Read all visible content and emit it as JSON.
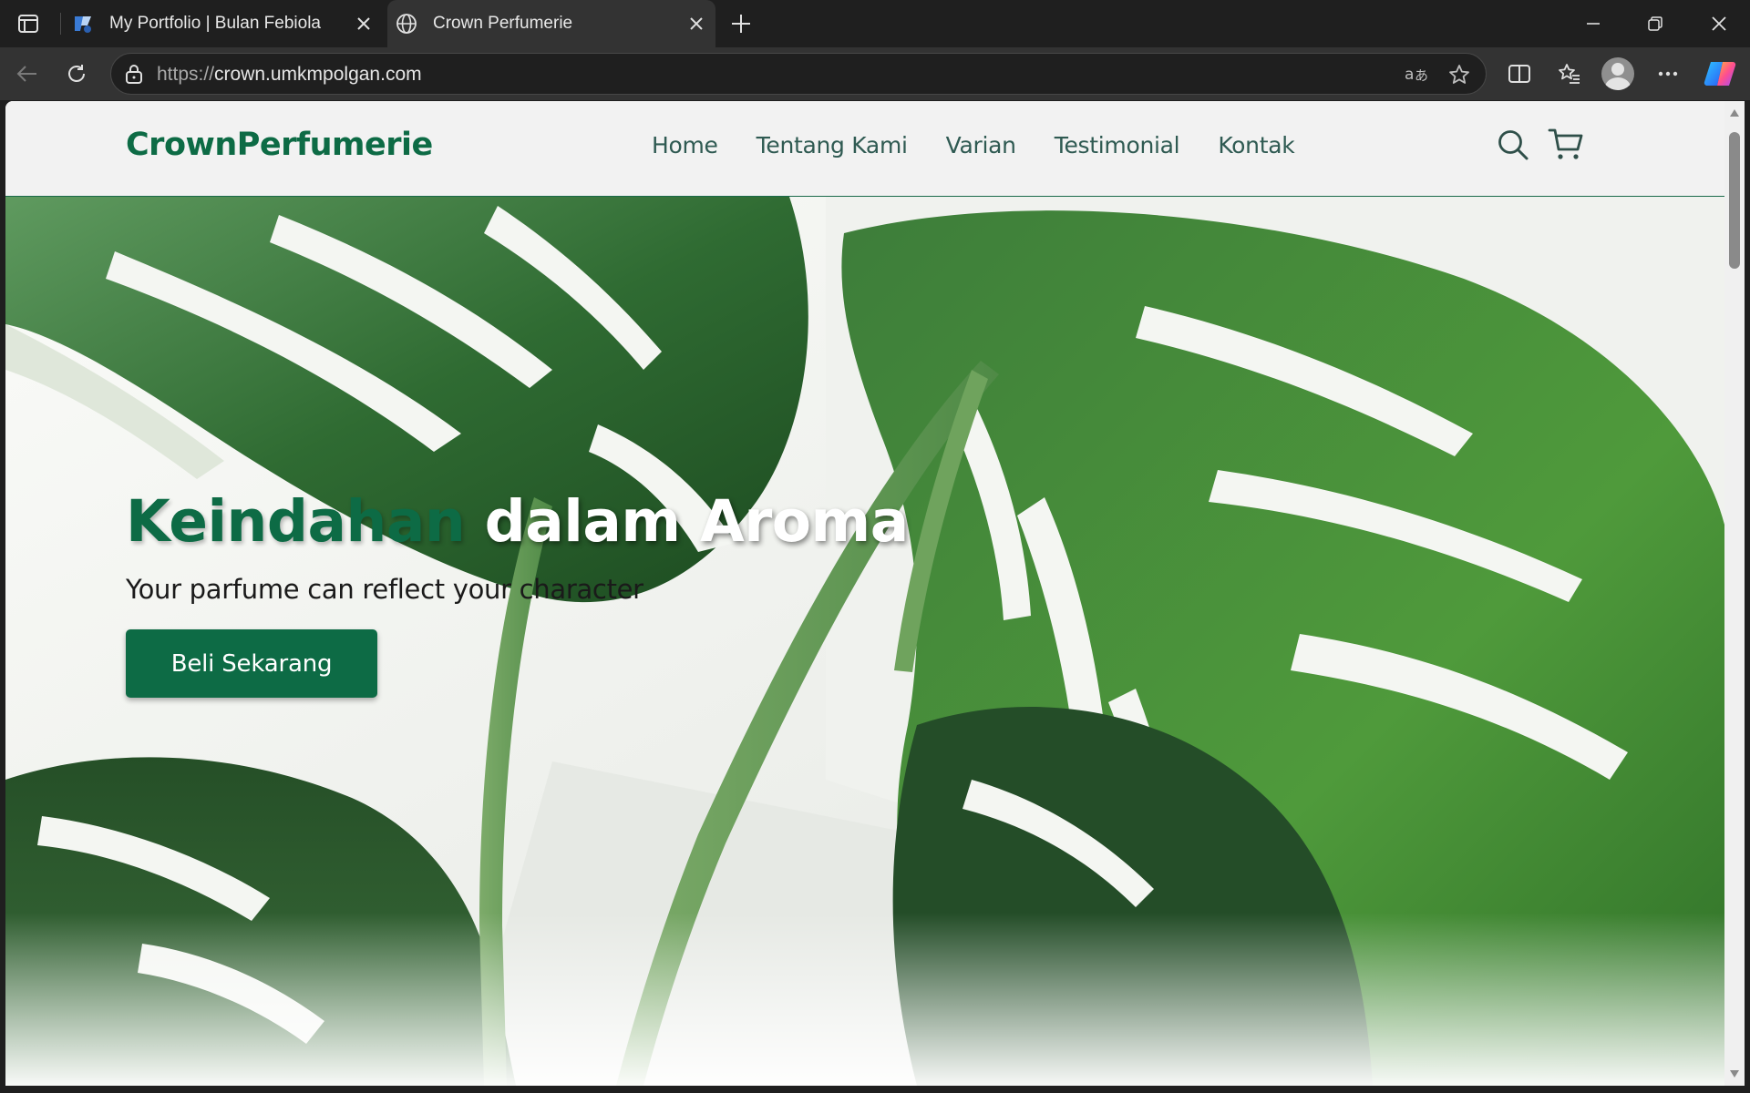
{
  "browser": {
    "tabs": [
      {
        "title": "My Portfolio | Bulan Febiola",
        "active": false,
        "icon": "portfolio-favicon"
      },
      {
        "title": "Crown Perfumerie",
        "active": true,
        "icon": "globe-icon"
      }
    ],
    "url_scheme": "https://",
    "url_host": "crown.umkmpolgan.com"
  },
  "site": {
    "logo": "CrownPerfumerie",
    "nav": [
      "Home",
      "Tentang Kami",
      "Varian",
      "Testimonial",
      "Kontak"
    ],
    "hero": {
      "title_part1": "Keindahan",
      "title_part2": " dalam Aroma",
      "subtitle": "Your parfume can reflect your character",
      "cta": "Beli Sekarang"
    }
  },
  "colors": {
    "brand_green": "#0d6b45",
    "nav_text": "#2f5a52",
    "chrome_dark": "#1f1f1f",
    "chrome_mid": "#333333"
  }
}
